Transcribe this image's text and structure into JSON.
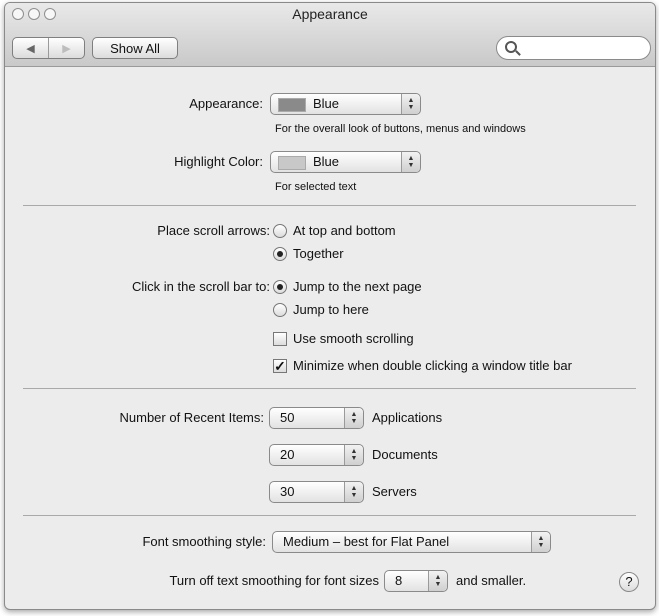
{
  "window": {
    "title": "Appearance"
  },
  "toolbar": {
    "back_icon": "◀",
    "forward_icon": "▶",
    "show_all": "Show All",
    "search_placeholder": ""
  },
  "appearance": {
    "label": "Appearance:",
    "value": "Blue",
    "hint": "For the overall look of buttons, menus and windows",
    "swatch_color": "#8a8a8a"
  },
  "highlight": {
    "label": "Highlight Color:",
    "value": "Blue",
    "hint": "For selected text",
    "swatch_color": "#c8c8c8"
  },
  "scroll_arrows": {
    "label": "Place scroll arrows:",
    "options": [
      {
        "label": "At top and bottom",
        "selected": false
      },
      {
        "label": "Together",
        "selected": true
      }
    ]
  },
  "scroll_click": {
    "label": "Click in the scroll bar to:",
    "options": [
      {
        "label": "Jump to the next page",
        "selected": true
      },
      {
        "label": "Jump to here",
        "selected": false
      }
    ]
  },
  "checkboxes": [
    {
      "label": "Use smooth scrolling",
      "checked": false
    },
    {
      "label": "Minimize when double clicking a window title bar",
      "checked": true
    }
  ],
  "recent": {
    "label": "Number of Recent Items:",
    "items": [
      {
        "value": "50",
        "label": "Applications"
      },
      {
        "value": "20",
        "label": "Documents"
      },
      {
        "value": "30",
        "label": "Servers"
      }
    ]
  },
  "font_smoothing": {
    "label": "Font smoothing style:",
    "value": "Medium – best for Flat Panel"
  },
  "text_smoothing": {
    "prefix": "Turn off text smoothing for font sizes",
    "value": "8",
    "suffix": "and smaller."
  },
  "help": {
    "label": "?"
  }
}
